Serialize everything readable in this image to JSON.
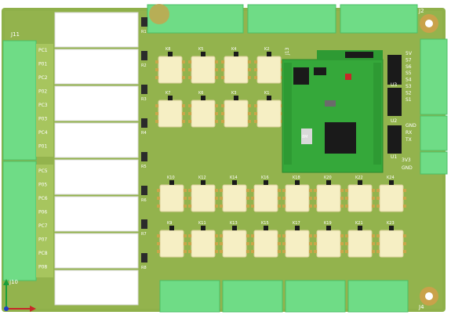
{
  "board": {
    "pcb_color": "#8fb04a",
    "pcb_dark": "#7c9a3d",
    "connector_color": "#6fdc86",
    "connector_dark": "#4bbf67",
    "relay_body": "#f6efc4",
    "relay_pin": "#c9a64a",
    "mcu_board_color": "#35a83a",
    "chip_color": "#1a1a1a",
    "label_color": "#ffffff"
  },
  "left_connector": {
    "header_label": "J11",
    "footer_label": "J10",
    "pins_top": [
      "PC1",
      "P01",
      "PC2",
      "P02",
      "PC3",
      "P03",
      "PC4",
      "P01"
    ],
    "pins_bottom": [
      "PC5",
      "P05",
      "PC6",
      "P06",
      "PC7",
      "P07",
      "PC8",
      "P08"
    ]
  },
  "corner_labels": {
    "top_right": "J2",
    "bottom_right": "J4"
  },
  "relays_top_row": [
    "K8",
    "K5",
    "K4",
    "K2"
  ],
  "relays_second_row": [
    "K7",
    "K6",
    "K3",
    "K1"
  ],
  "relays_third_row": [
    "K10",
    "K12",
    "K14",
    "K16",
    "K18",
    "K20",
    "K22",
    "K24"
  ],
  "relays_bottom_row": [
    "K9",
    "K11",
    "K13",
    "K15",
    "K17",
    "K19",
    "K21",
    "K23"
  ],
  "side_resistors": [
    "R1",
    "R2",
    "R3",
    "R4",
    "R5",
    "R6",
    "R7",
    "R8"
  ],
  "right_labels": [
    "5V",
    "S7",
    "S6",
    "S5",
    "S4",
    "S3",
    "S2",
    "S1",
    "GND",
    "RX",
    "TX"
  ],
  "right_ics": [
    "U3",
    "U2",
    "U1"
  ],
  "mcu_module": {
    "label": "J13",
    "crystal_label": "8M"
  },
  "bottom_side_label": "3V3",
  "bottom_gnd_label": "GND",
  "icons": [
    "axis-origin-icon"
  ]
}
